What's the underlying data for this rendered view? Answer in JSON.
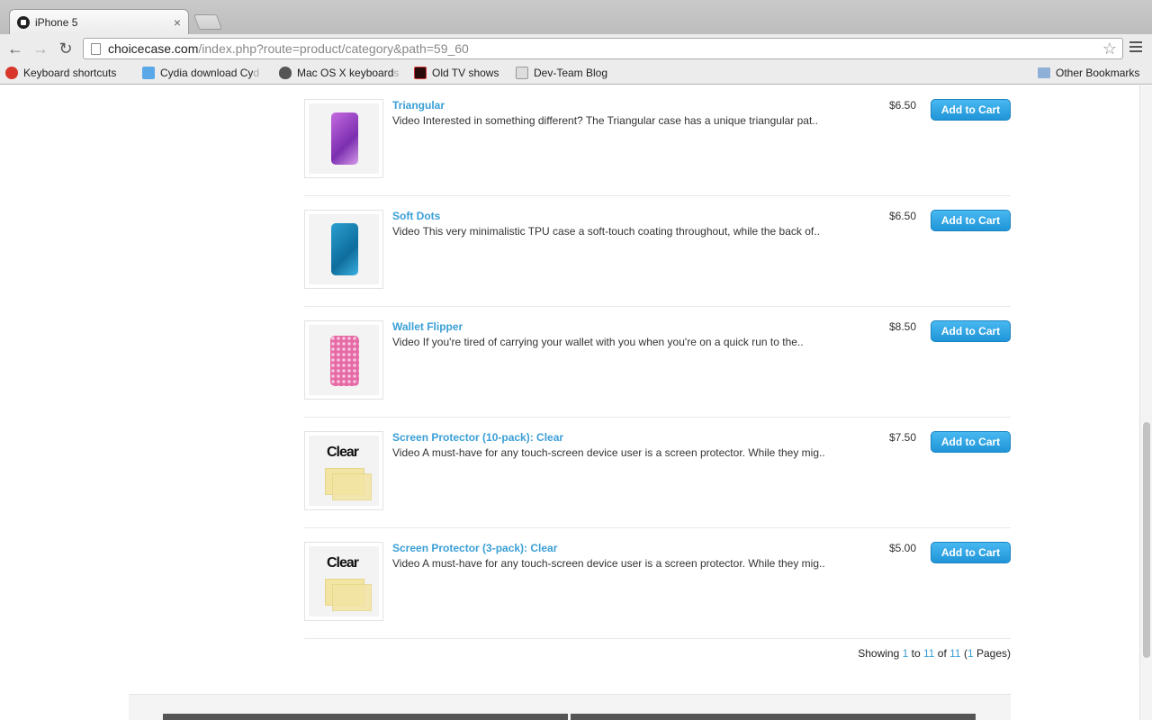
{
  "browser": {
    "tab_title": "iPhone 5",
    "url_host": "choicecase.com",
    "url_path": "/index.php?route=product/category&path=59_60",
    "bookmarks": [
      {
        "label": "Keyboard shortcuts",
        "fade": " ",
        "icon": "red-app-icon"
      },
      {
        "label": "Cydia download Cy",
        "fade": "d",
        "icon": "cydia-icon"
      },
      {
        "label": "Mac OS X keyboard",
        "fade": " s",
        "icon": "apple-icon"
      },
      {
        "label": "Old TV shows",
        "fade": "",
        "icon": "tv-icon"
      },
      {
        "label": "Dev-Team Blog",
        "fade": "",
        "icon": "devteam-icon"
      }
    ],
    "other_bookmarks": "Other Bookmarks"
  },
  "products": [
    {
      "name": "Triangular",
      "desc": "Video Interested in something different? The Triangular case has a unique triangular pat..",
      "price": "$6.50",
      "cart": "Add to Cart"
    },
    {
      "name": "Soft Dots",
      "desc": "Video This very minimalistic TPU case a soft-touch coating throughout, while the back of..",
      "price": "$6.50",
      "cart": "Add to Cart"
    },
    {
      "name": "Wallet Flipper",
      "desc": "Video If you're tired of carrying your wallet with you when you're on a quick run to the..",
      "price": "$8.50",
      "cart": "Add to Cart"
    },
    {
      "name": "Screen Protector (10-pack): Clear",
      "desc": "Video A must-have for any touch-screen device user is a screen protector. While they mig..",
      "price": "$7.50",
      "cart": "Add to Cart",
      "thumb_label": "Clear"
    },
    {
      "name": "Screen Protector (3-pack): Clear",
      "desc": "Video A must-have for any touch-screen device user is a screen protector. While they mig..",
      "price": "$5.00",
      "cart": "Add to Cart",
      "thumb_label": "Clear"
    }
  ],
  "pagination": {
    "prefix": "Showing ",
    "from": "1",
    "to_word": " to ",
    "to": "11",
    "of_word": " of ",
    "total": "11",
    "pages_open": " (",
    "pages": "1",
    "pages_close": " Pages)"
  },
  "colors": {
    "link": "#3a9fd6",
    "button": "#1f95d8"
  }
}
